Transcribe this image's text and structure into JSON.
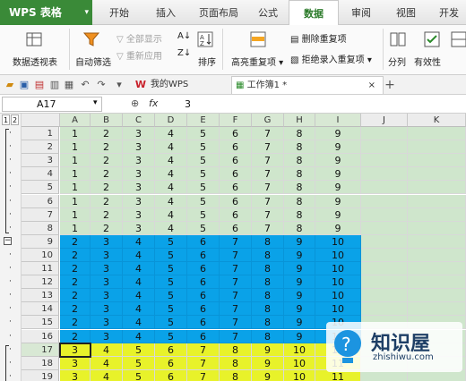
{
  "app": {
    "brand": "WPS 表格",
    "brand_dropdown": "▾"
  },
  "tabs": [
    "开始",
    "插入",
    "页面布局",
    "公式",
    "数据",
    "审阅",
    "视图",
    "开发"
  ],
  "active_tab": "数据",
  "ribbon": {
    "pivot": "数据透视表",
    "autofilter": "自动筛选",
    "show_all": "全部显示",
    "reapply": "重新应用",
    "sort": "排序",
    "highlight_dup": "高亮重复项",
    "delete_dup": "删除重复项",
    "reject_dup": "拒绝录入重复项",
    "split": "分列",
    "validity": "有效性"
  },
  "toolbar": {
    "doc_tab1": "我的WPS",
    "doc_tab2": "工作簿1 *",
    "close": "×",
    "new_tab": "+"
  },
  "formula_bar": {
    "cell_ref": "A17",
    "fx": "fx",
    "value": "3",
    "zoom_icon": "⊕"
  },
  "outline_levels": [
    "1",
    "2"
  ],
  "columns": [
    "A",
    "B",
    "C",
    "D",
    "E",
    "F",
    "G",
    "H",
    "I",
    "J",
    "K"
  ],
  "rows": [
    {
      "n": "1",
      "v": [
        "1",
        "2",
        "3",
        "4",
        "5",
        "6",
        "7",
        "8",
        "9"
      ]
    },
    {
      "n": "2",
      "v": [
        "1",
        "2",
        "3",
        "4",
        "5",
        "6",
        "7",
        "8",
        "9"
      ]
    },
    {
      "n": "3",
      "v": [
        "1",
        "2",
        "3",
        "4",
        "5",
        "6",
        "7",
        "8",
        "9"
      ]
    },
    {
      "n": "4",
      "v": [
        "1",
        "2",
        "3",
        "4",
        "5",
        "6",
        "7",
        "8",
        "9"
      ]
    },
    {
      "n": "5",
      "v": [
        "1",
        "2",
        "3",
        "4",
        "5",
        "6",
        "7",
        "8",
        "9"
      ]
    },
    {
      "n": "6",
      "v": [
        "1",
        "2",
        "3",
        "4",
        "5",
        "6",
        "7",
        "8",
        "9"
      ]
    },
    {
      "n": "7",
      "v": [
        "1",
        "2",
        "3",
        "4",
        "5",
        "6",
        "7",
        "8",
        "9"
      ]
    },
    {
      "n": "8",
      "v": [
        "1",
        "2",
        "3",
        "4",
        "5",
        "6",
        "7",
        "8",
        "9"
      ]
    },
    {
      "n": "9",
      "v": [
        "2",
        "3",
        "4",
        "5",
        "6",
        "7",
        "8",
        "9",
        "10"
      ]
    },
    {
      "n": "10",
      "v": [
        "2",
        "3",
        "4",
        "5",
        "6",
        "7",
        "8",
        "9",
        "10"
      ]
    },
    {
      "n": "11",
      "v": [
        "2",
        "3",
        "4",
        "5",
        "6",
        "7",
        "8",
        "9",
        "10"
      ]
    },
    {
      "n": "12",
      "v": [
        "2",
        "3",
        "4",
        "5",
        "6",
        "7",
        "8",
        "9",
        "10"
      ]
    },
    {
      "n": "13",
      "v": [
        "2",
        "3",
        "4",
        "5",
        "6",
        "7",
        "8",
        "9",
        "10"
      ]
    },
    {
      "n": "14",
      "v": [
        "2",
        "3",
        "4",
        "5",
        "6",
        "7",
        "8",
        "9",
        "10"
      ]
    },
    {
      "n": "15",
      "v": [
        "2",
        "3",
        "4",
        "5",
        "6",
        "7",
        "8",
        "9",
        "10"
      ]
    },
    {
      "n": "16",
      "v": [
        "2",
        "3",
        "4",
        "5",
        "6",
        "7",
        "8",
        "9",
        "10"
      ]
    },
    {
      "n": "17",
      "v": [
        "3",
        "4",
        "5",
        "6",
        "7",
        "8",
        "9",
        "10",
        "11"
      ]
    },
    {
      "n": "18",
      "v": [
        "3",
        "4",
        "5",
        "6",
        "7",
        "8",
        "9",
        "10",
        "11"
      ]
    },
    {
      "n": "19",
      "v": [
        "3",
        "4",
        "5",
        "6",
        "7",
        "8",
        "9",
        "10",
        "11"
      ]
    }
  ],
  "colors": {
    "green_band": "#cfe6cc",
    "blue_band": "#0aa2e8",
    "yellow_band": "#e8f22a",
    "active_tab": "#2a7a29"
  },
  "watermark": {
    "title": "知识屋",
    "sub": "zhishiwu.com"
  }
}
